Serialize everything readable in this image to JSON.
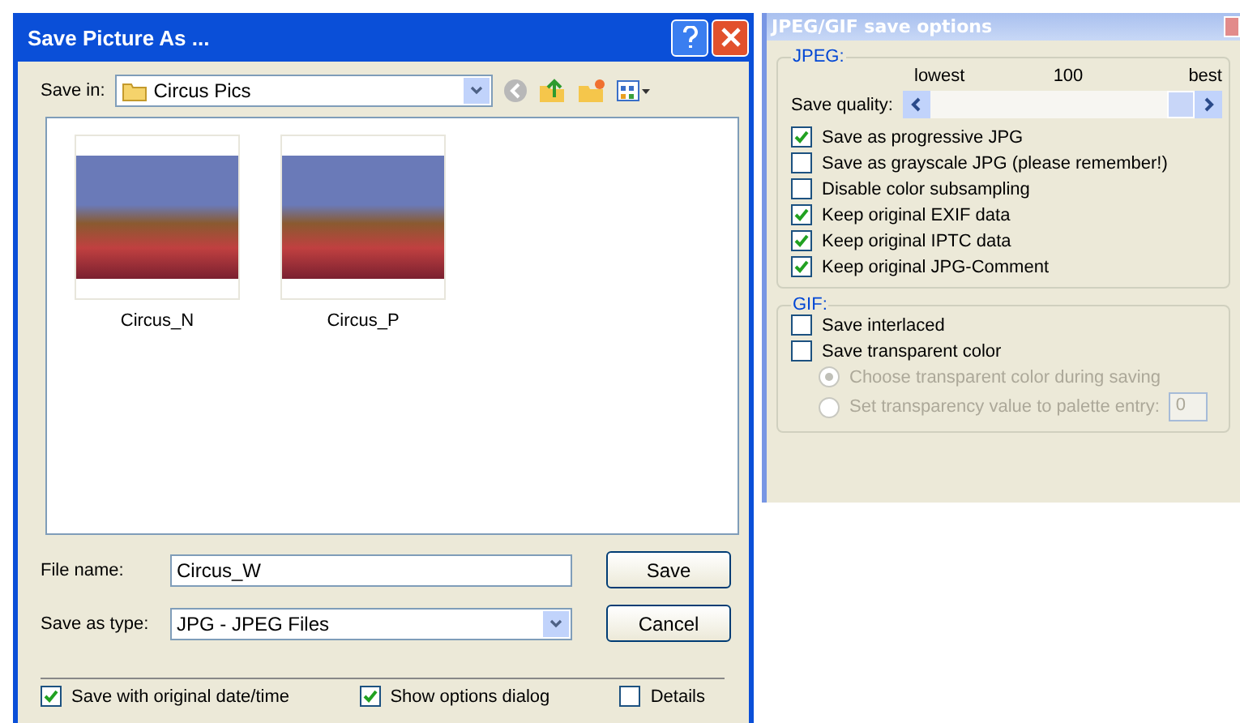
{
  "dialog": {
    "title": "Save Picture As ...",
    "save_in_label": "Save in:",
    "save_in_value": "Circus Pics",
    "files": [
      {
        "name": "Circus_N",
        "selected": false
      },
      {
        "name": "Circus_P",
        "selected": false
      }
    ],
    "file_name_label": "File name:",
    "file_name_value": "Circus_W",
    "type_label": "Save as type:",
    "type_value": "JPG - JPEG Files",
    "buttons": [
      "Save",
      "Cancel"
    ],
    "options": [
      {
        "label": "Save with original date/time",
        "checked": true
      },
      {
        "label": "Show options dialog",
        "checked": true
      },
      {
        "label": "Details",
        "checked": false
      }
    ]
  },
  "options_panel": {
    "title": "JPEG/GIF save options",
    "jpeg": {
      "legend": "JPEG:",
      "scale_low": "lowest",
      "scale_value": "100",
      "scale_high": "best",
      "quality_label": "Save quality:",
      "level": 1,
      "items": [
        {
          "label": "Save as progressive JPG",
          "checked": true
        },
        {
          "label": "Save as grayscale JPG (please remember!)",
          "checked": false
        },
        {
          "label": "Disable color subsampling",
          "checked": false
        },
        {
          "label": "Keep original EXIF data",
          "checked": true
        },
        {
          "label": "Keep original IPTC data",
          "checked": true
        },
        {
          "label": "Keep original JPG-Comment",
          "checked": true
        }
      ]
    },
    "gif": {
      "legend": "GIF:",
      "items": [
        {
          "kind": "checkbox",
          "label": "Save interlaced",
          "checked": false,
          "disabled": false
        },
        {
          "kind": "checkbox",
          "label": "Save transparent color",
          "checked": false,
          "disabled": false
        },
        {
          "kind": "radio",
          "label": "Choose transparent color during saving",
          "selected": true,
          "disabled": true
        },
        {
          "kind": "radio",
          "label": "Set transparency value to palette entry:",
          "selected": false,
          "disabled": true,
          "value": "0"
        }
      ]
    }
  }
}
